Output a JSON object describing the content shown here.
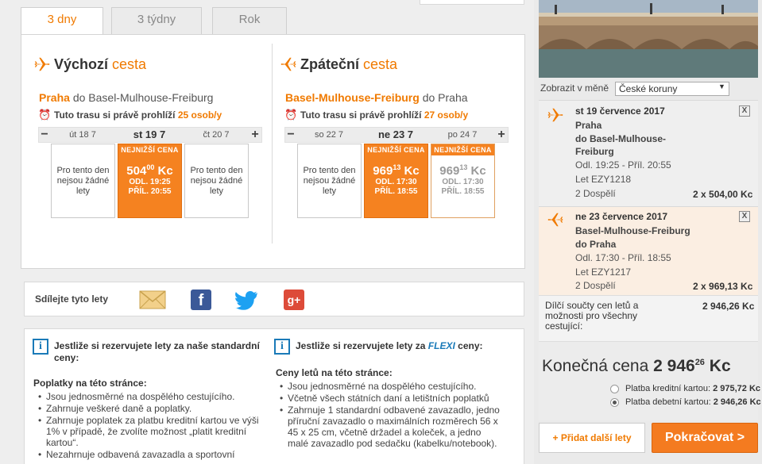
{
  "tabs": [
    {
      "label": "3 dny",
      "active": true
    },
    {
      "label": "3 týdny",
      "active": false
    },
    {
      "label": "Rok",
      "active": false
    }
  ],
  "outbound": {
    "title_a": "Výchozí",
    "title_b": "cesta",
    "from": "Praha",
    "route_mid": "do",
    "to": "Basel-Mulhouse-Freiburg",
    "viewers_text": "Tuto trasu si právě prohlíží",
    "viewers_count": "25 osob/y",
    "days": [
      "út 18 7",
      "st 19 7",
      "čt 20 7"
    ],
    "cards": [
      {
        "type": "empty",
        "text": "Pro tento den nejsou žádné lety"
      },
      {
        "type": "best",
        "badge": "NEJNIŽŠÍ CENA",
        "price": "504",
        "cents": "00",
        "currency": "Kc",
        "dep": "ODL. 19:25",
        "arr": "PŘÍL. 20:55"
      },
      {
        "type": "empty",
        "text": "Pro tento den nejsou žádné lety"
      }
    ]
  },
  "inbound": {
    "title_a": "Zpáteční",
    "title_b": "cesta",
    "from": "Basel-Mulhouse-Freiburg",
    "route_mid": "do",
    "to": "Praha",
    "viewers_text": "Tuto trasu si právě prohlíží",
    "viewers_count": "27 osob/y",
    "days": [
      "so 22 7",
      "ne 23 7",
      "po 24 7"
    ],
    "cards": [
      {
        "type": "empty",
        "text": "Pro tento den nejsou žádné lety"
      },
      {
        "type": "best",
        "badge": "NEJNIŽŠÍ CENA",
        "price": "969",
        "cents": "13",
        "currency": "Kc",
        "dep": "ODL. 17:30",
        "arr": "PŘÍL. 18:55"
      },
      {
        "type": "outline",
        "badge": "NEJNIŽŠÍ CENA",
        "price": "969",
        "cents": "13",
        "currency": "Kc",
        "dep": "ODL. 17:30",
        "arr": "PŘÍL. 18:55"
      }
    ]
  },
  "share": {
    "label": "Sdílejte tyto lety"
  },
  "info_standard": {
    "heading": "Jestliže si rezervujete lety za naše standardní ceny:",
    "sub": "Poplatky na této stránce:",
    "items": [
      "Jsou jednosměrné na dospělého cestujícího.",
      "Zahrnuje veškeré daně a poplatky.",
      "Zahrnuje poplatek za platbu kreditní kartou ve výši 1% v případě, že zvolíte možnost „platit kreditní kartou“.",
      "Nezahrnuje odbavená zavazadla a sportovní"
    ]
  },
  "info_flexi": {
    "heading_a": "Jestliže si rezervujete lety za",
    "heading_flexi": "FLEXI",
    "heading_b": "ceny:",
    "sub": "Ceny letů na této stránce:",
    "items": [
      "Jsou jednosměrné na dospělého cestujícího.",
      "Včetně všech státních daní a letištních poplatků",
      "Zahrnuje 1 standardní odbavené zavazadlo, jedno příruční zavazadlo o maximálních rozměrech 56 x 45 x 25 cm, včetně držadel a koleček, a jedno malé zavazadlo pod sedačku (kabelku/notebook)."
    ]
  },
  "sidebar": {
    "currency_label": "Zobrazit v měně",
    "currency_value": "České koruny",
    "legs": [
      {
        "date": "st 19 července 2017",
        "from": "Praha",
        "to_line1": "do Basel-Mulhouse-",
        "to_line2": "Freiburg",
        "times": "Odl. 19:25 - Příl. 20:55",
        "flight": "Let EZY1218",
        "pax": "2 Dospělí",
        "price": "2 x 504,00 Kc"
      },
      {
        "date": "ne 23 července 2017",
        "from": "Basel-Mulhouse-Freiburg",
        "to_line1": "do Praha",
        "to_line2": "",
        "times": "Odl. 17:30 - Příl. 18:55",
        "flight": "Let EZY1217",
        "pax": "2 Dospělí",
        "price": "2 x 969,13 Kc"
      }
    ],
    "subtotal_label": "Dílčí součty cen letů a možnosti pro všechny cestující:",
    "subtotal_value": "2 946,26 Kc",
    "total_label": "Konečná cena",
    "total_main": "2 946",
    "total_cents": "26",
    "total_currency": "Kc",
    "pay_credit_label": "Platba kreditní kartou:",
    "pay_credit_value": "2 975,72 Kc",
    "pay_debit_label": "Platba debetní kartou:",
    "pay_debit_value": "2 946,26 Kc",
    "add_flights": "Přidat další lety",
    "continue": "Pokračovat",
    "close_glyph": "X",
    "plus_glyph": "+",
    "continue_glyph": ">"
  },
  "colors": {
    "accent": "#f07a00",
    "info": "#1a7ab8",
    "facebook": "#3b5998",
    "twitter": "#1da1f2",
    "gplus": "#dd4b39"
  }
}
